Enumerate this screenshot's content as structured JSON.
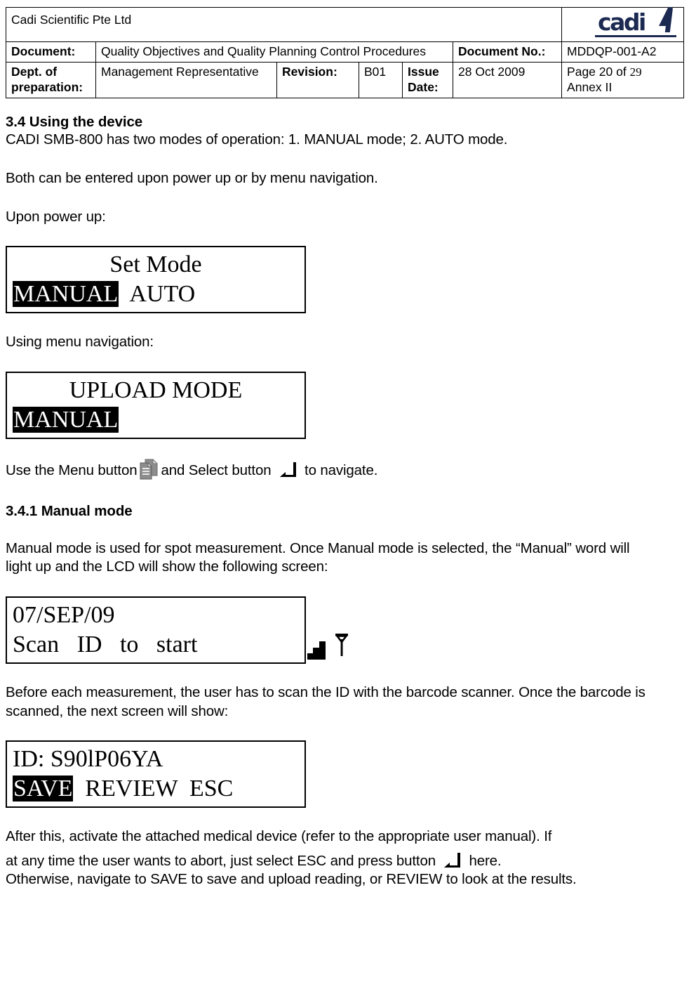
{
  "header": {
    "company": "Cadi Scientific Pte Ltd",
    "logo_text": "cadi",
    "rows": {
      "document_label": "Document:",
      "document_value": "Quality Objectives and Quality Planning Control Procedures",
      "document_no_label": "Document No.:",
      "document_no_value": "MDDQP-001-A2",
      "dept_label": "Dept. of preparation:",
      "dept_value": "Management Representative",
      "revision_label": "Revision:",
      "revision_value": "B01",
      "issue_date_label": "Issue Date:",
      "issue_date_value": "28 Oct 2009",
      "page_prefix": "Page 20 of ",
      "page_total": "29",
      "annex": "Annex II"
    }
  },
  "content": {
    "section_heading": "3.4 Using the device",
    "intro_line": "CADI SMB-800 has two modes of operation: 1. MANUAL mode; 2. AUTO mode.",
    "para_both_modes": "Both can be entered upon power up or by menu navigation.",
    "label_power_up": "Upon power up:",
    "label_menu_nav": "Using menu navigation:",
    "nav_instruction": {
      "part1": "Use the Menu button",
      "part2": "and Select button",
      "part3": "to navigate."
    },
    "subsection_heading": "3.4.1 Manual mode",
    "para_manual_mode": "Manual mode is used for spot measurement. Once Manual mode is selected, the “Manual” word will light up and the LCD will show the following screen:",
    "para_before_measurement": "Before each measurement, the user has to scan the ID with the barcode scanner. Once the barcode is scanned, the next screen will show:",
    "para_after_this_1": "After this, activate the attached medical device (refer to the appropriate user manual). If",
    "para_after_this_2a": "at any time the user wants to abort, just select ESC and press button",
    "para_after_this_2b": "here.",
    "para_after_this_3": "Otherwise, navigate to SAVE to save and upload reading, or REVIEW to look at the results."
  },
  "lcd_screens": {
    "set_mode": {
      "line1": "Set Mode",
      "option_selected": "MANUAL",
      "option_other": "AUTO"
    },
    "upload_mode": {
      "line1": "UPLOAD MODE",
      "line2_selected": "MANUAL"
    },
    "scan_id": {
      "date": "07/SEP/09",
      "line2": "Scan   ID   to   start",
      "icon_signal": "signal-bars-icon",
      "icon_antenna": "antenna-icon"
    },
    "id_actions": {
      "line1": "ID: S90lP06YA",
      "option_selected": "SAVE",
      "option_review": "REVIEW",
      "option_esc": "ESC"
    }
  },
  "icons": {
    "menu_button": "menu-pages-icon",
    "select_button": "enter-arrow-icon"
  },
  "colors": {
    "logo": "#1c2a52",
    "text": "#000000",
    "border": "#000000"
  }
}
